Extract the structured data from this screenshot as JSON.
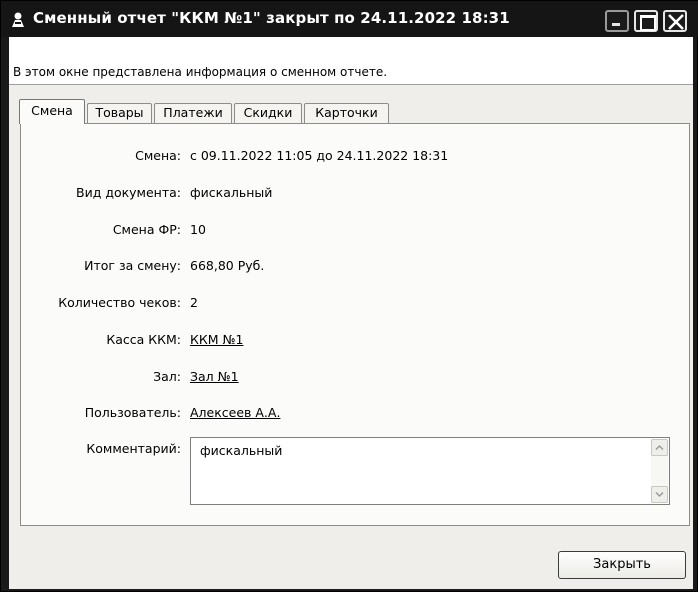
{
  "window": {
    "title": "Сменный отчет \"ККМ №1\" закрыт по 24.11.2022 18:31",
    "icon": "user-icon"
  },
  "info": {
    "text": "В этом окне представлена информация о сменном отчете."
  },
  "tabs": [
    {
      "label": "Смена",
      "active": true
    },
    {
      "label": "Товары",
      "active": false
    },
    {
      "label": "Платежи",
      "active": false
    },
    {
      "label": "Скидки",
      "active": false
    },
    {
      "label": "Карточки",
      "active": false
    }
  ],
  "fields": {
    "shift": {
      "label": "Смена:",
      "value": "с 09.11.2022 11:05 до 24.11.2022 18:31"
    },
    "doc_type": {
      "label": "Вид документа:",
      "value": "фискальный"
    },
    "fr_shift": {
      "label": "Смена ФР:",
      "value": "10"
    },
    "total": {
      "label": "Итог за смену:",
      "value": "668,80 Руб."
    },
    "receipts": {
      "label": "Количество чеков:",
      "value": "2"
    },
    "kkm": {
      "label": "Касса ККМ:",
      "value": "ККМ №1"
    },
    "hall": {
      "label": "Зал:",
      "value": "Зал №1"
    },
    "user": {
      "label": "Пользователь:",
      "value": "Алексеев А.А."
    },
    "comment": {
      "label": "Комментарий:",
      "value": "фискальный"
    }
  },
  "buttons": {
    "close": "Закрыть"
  }
}
